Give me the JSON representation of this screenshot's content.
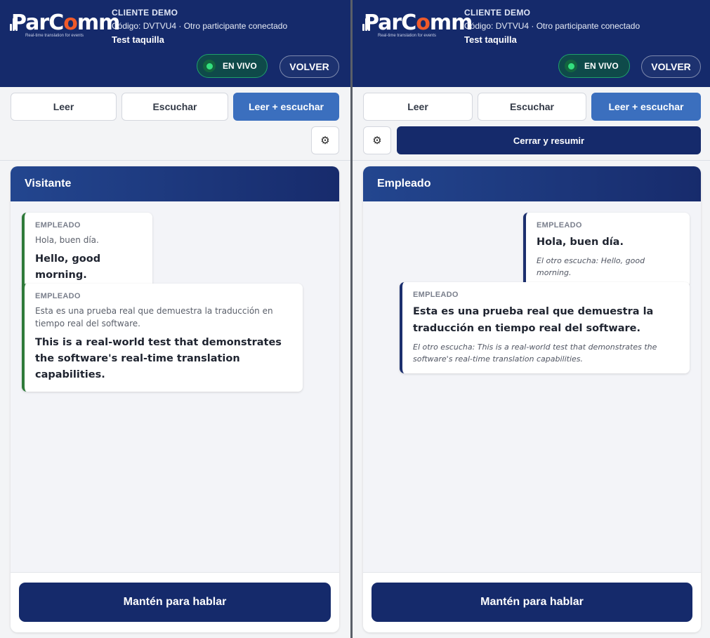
{
  "brand": {
    "logo_main": "ParC",
    "logo_o": "o",
    "logo_end": "mm",
    "tagline": "Real-time translation for events"
  },
  "session": {
    "client": "CLIENTE DEMO",
    "info": "Código: DVTVU4 · Otro participante conectado",
    "event": "Test taquilla"
  },
  "controls": {
    "live_label": "EN VIVO",
    "back_label": "VOLVER",
    "modes": [
      "Leer",
      "Escuchar",
      "Leer + escuchar"
    ],
    "active_mode": "Leer + escuchar",
    "close_label": "Cerrar y resumir",
    "talk_label": "Mantén para hablar"
  },
  "colors": {
    "header": "#152a6b",
    "accent": "#3b6fbe",
    "live": "#33e07f",
    "brand_o": "#ef5a2a"
  },
  "panes": {
    "left": {
      "title": "Visitante",
      "messages": [
        {
          "speaker": "EMPLEADO",
          "original": "Hola, buen día.",
          "translation": "Hello, good morning."
        },
        {
          "speaker": "EMPLEADO",
          "original": "Esta es una prueba real que demuestra la traducción en tiempo real del software.",
          "translation": "This is a real-world test that demonstrates the software's real-time translation capabilities."
        }
      ]
    },
    "right": {
      "title": "Empleado",
      "messages": [
        {
          "speaker": "EMPLEADO",
          "text": "Hola, buen día.",
          "heard": "El otro escucha: Hello, good morning."
        },
        {
          "speaker": "EMPLEADO",
          "text": "Esta es una prueba real que demuestra la traducción en tiempo real del software.",
          "heard": "El otro escucha: This is a real-world test that demonstrates the software's real-time translation capabilities."
        }
      ]
    }
  }
}
